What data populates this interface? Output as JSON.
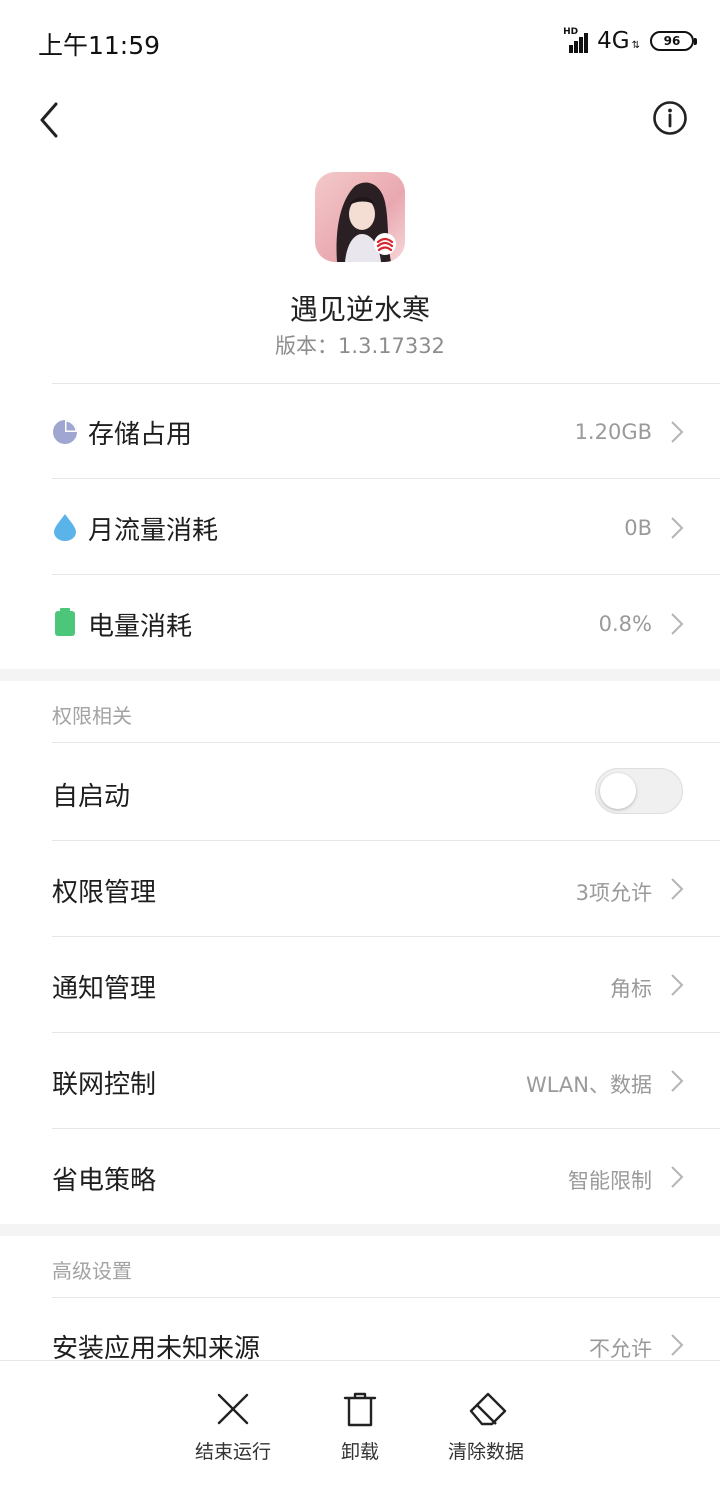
{
  "status_bar": {
    "time": "上午11:59",
    "signal_badge": "HD",
    "network": "4G",
    "battery_level": "96"
  },
  "app": {
    "name": "遇见逆水寒",
    "version": "版本：1.3.17332"
  },
  "usage_rows": [
    {
      "label": "存储占用",
      "value": "1.20GB",
      "icon": "pie-chart-icon"
    },
    {
      "label": "月流量消耗",
      "value": "0B",
      "icon": "water-drop-icon"
    },
    {
      "label": "电量消耗",
      "value": "0.8%",
      "icon": "battery-icon"
    }
  ],
  "permissions_section": {
    "title": "权限相关",
    "autostart_label": "自启动",
    "autostart_enabled": false,
    "rows": [
      {
        "label": "权限管理",
        "value": "3项允许"
      },
      {
        "label": "通知管理",
        "value": "角标"
      },
      {
        "label": "联网控制",
        "value": "WLAN、数据"
      },
      {
        "label": "省电策略",
        "value": "智能限制"
      }
    ]
  },
  "advanced_section": {
    "title": "高级设置",
    "rows": [
      {
        "label": "安装应用未知来源",
        "value": "不允许"
      }
    ]
  },
  "bottom_actions": [
    {
      "label": "结束运行",
      "icon": "close-icon"
    },
    {
      "label": "卸载",
      "icon": "trash-icon"
    },
    {
      "label": "清除数据",
      "icon": "eraser-icon"
    }
  ],
  "colors": {
    "storage_icon": "#9fa6d2",
    "data_icon": "#5ab4ea",
    "battery_icon": "#4cc77a",
    "value_text": "#9a9a9a",
    "section_band": "#f4f4f4"
  }
}
